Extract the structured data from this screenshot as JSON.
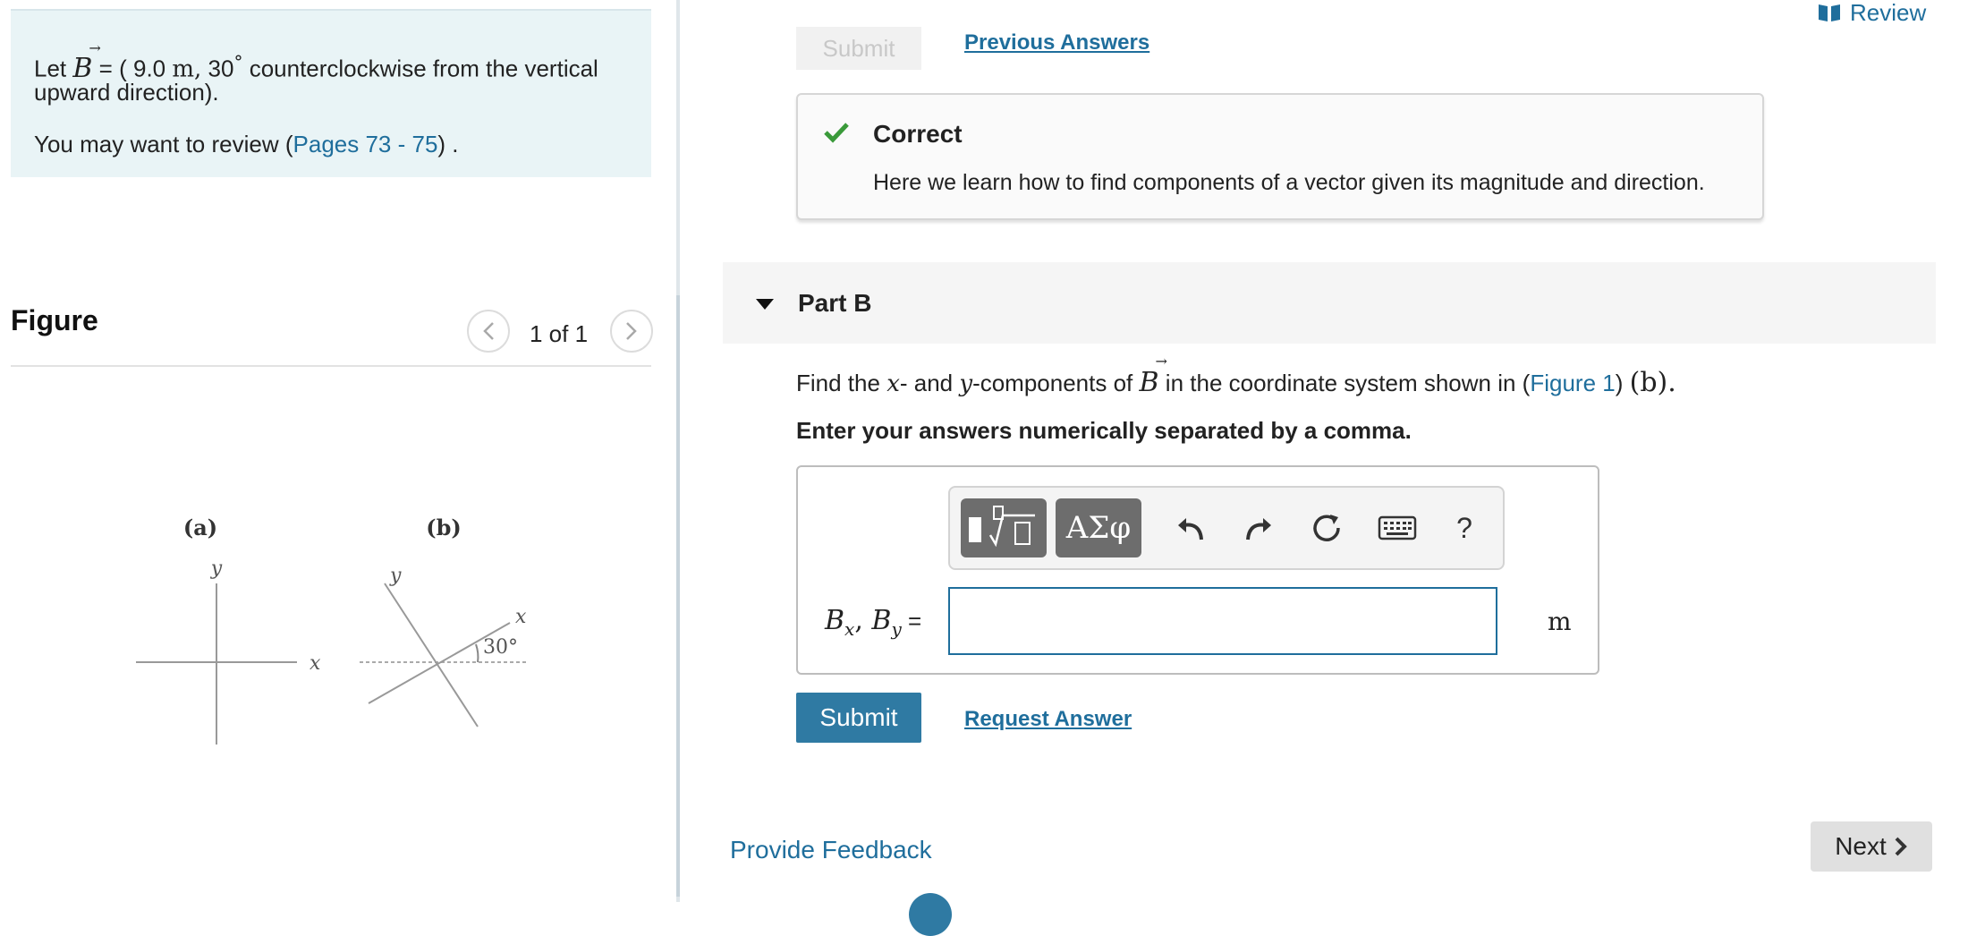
{
  "header": {
    "review_label": "Review"
  },
  "problem": {
    "let_prefix": "Let",
    "vector_symbol": "B",
    "equals_open": "= (",
    "magnitude": "9.0",
    "unit": "m,",
    "angle": "30",
    "degree": "°",
    "direction_text": "counterclockwise from the vertical",
    "direction_text2": "upward direction).",
    "review_prefix": "You may want to review (",
    "review_link": "Pages 73 - 75",
    "review_suffix": ") ."
  },
  "figure": {
    "title": "Figure",
    "pager": "1 of 1",
    "panel_a_label": "(a)",
    "panel_b_label": "(b)",
    "axis_y": "y",
    "axis_x": "x",
    "angle_label": "30°"
  },
  "part_a": {
    "submit_label": "Submit",
    "previous_answers_label": "Previous Answers",
    "feedback_title": "Correct",
    "feedback_text": "Here we learn how to find components of a vector given its magnitude and direction."
  },
  "part_b": {
    "title": "Part B",
    "q_find": "Find the",
    "q_x": "x",
    "q_and": "- and",
    "q_y": "y",
    "q_components": "-components of",
    "q_vec": "B",
    "q_in": "in the coordinate system shown in (",
    "q_figure_link": "Figure 1",
    "q_close": ")",
    "q_b": "(b).",
    "instruction": "Enter your answers numerically separated by a comma.",
    "answer_label_bx": "B",
    "answer_label_sub_x": "x",
    "answer_label_comma": ", ",
    "answer_label_by": "B",
    "answer_label_sub_y": "y",
    "answer_label_eq": " =",
    "answer_value": "",
    "unit": "m",
    "toolbar": {
      "greek_label": "ΑΣφ",
      "help_label": "?"
    },
    "submit_label": "Submit",
    "request_answer_label": "Request Answer"
  },
  "footer": {
    "feedback_link": "Provide Feedback",
    "next_label": "Next"
  }
}
